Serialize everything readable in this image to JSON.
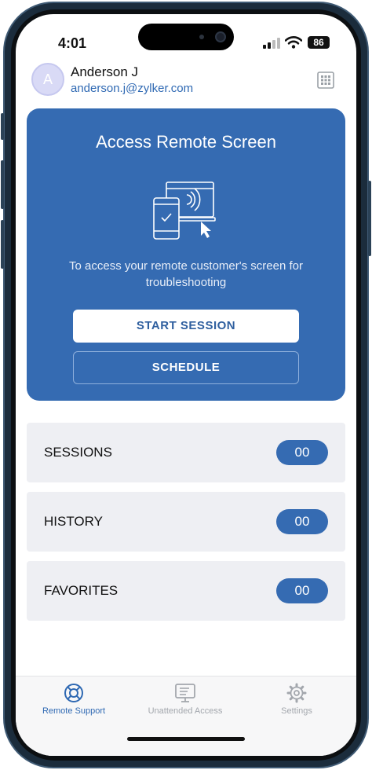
{
  "status_bar": {
    "time": "4:01",
    "battery": "86"
  },
  "user": {
    "initial": "A",
    "name": "Anderson J",
    "email": "anderson.j@zylker.com"
  },
  "card": {
    "title": "Access Remote Screen",
    "description": "To access your remote customer's screen for troubleshooting",
    "start_label": "START SESSION",
    "schedule_label": "SCHEDULE"
  },
  "stats": [
    {
      "label": "SESSIONS",
      "count": "00"
    },
    {
      "label": "HISTORY",
      "count": "00"
    },
    {
      "label": "FAVORITES",
      "count": "00"
    }
  ],
  "tabs": [
    {
      "label": "Remote Support",
      "icon": "lifebuoy-icon",
      "active": true
    },
    {
      "label": "Unattended Access",
      "icon": "monitor-list-icon",
      "active": false
    },
    {
      "label": "Settings",
      "icon": "gear-icon",
      "active": false
    }
  ],
  "colors": {
    "accent": "#356bb2",
    "link": "#2f69b3",
    "row_bg": "#eeeff3"
  }
}
